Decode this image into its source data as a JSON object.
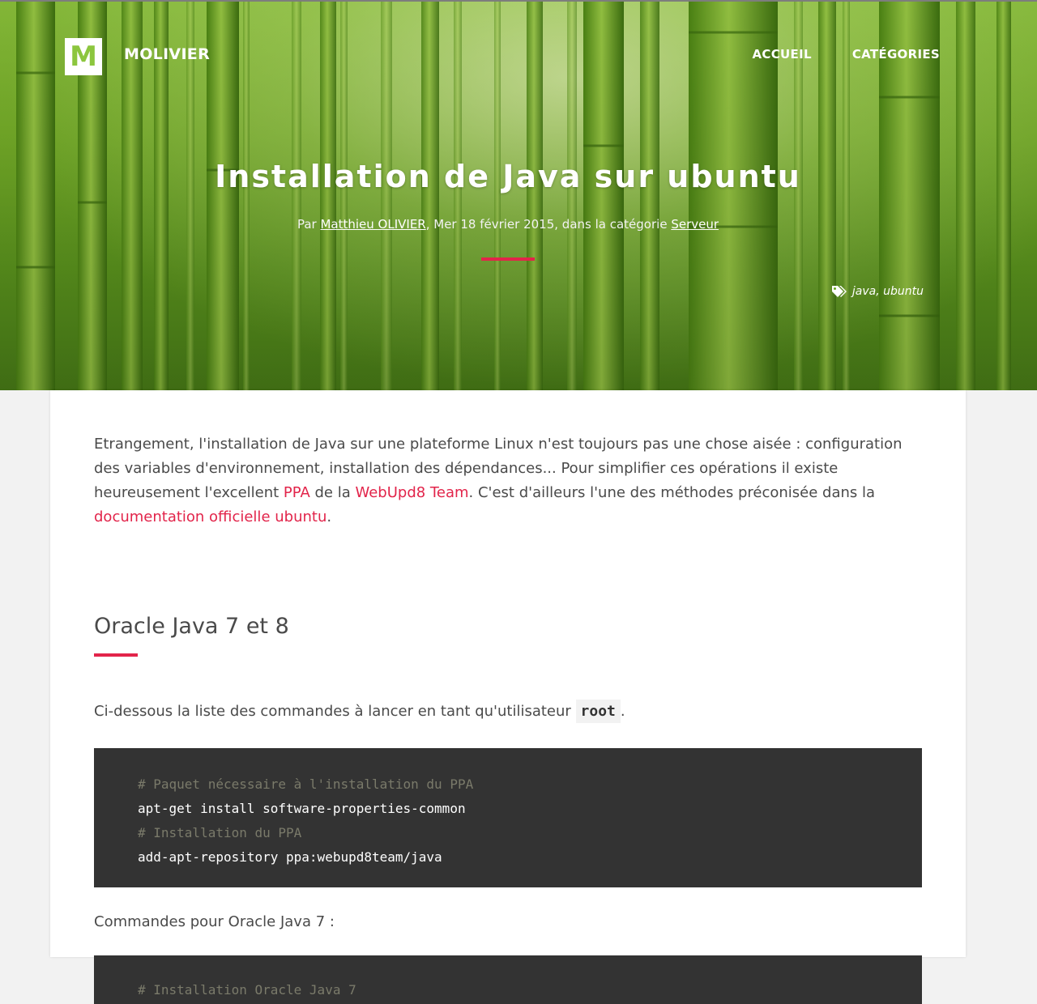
{
  "header": {
    "logo_letter": "M",
    "brand": "MOLIVIER",
    "nav": [
      "ACCUEIL",
      "CATÉGORIES"
    ]
  },
  "article": {
    "title": "Installation de Java sur ubuntu",
    "meta": {
      "prefix": "Par ",
      "author": "Matthieu OLIVIER",
      "middle": ", Mer 18 février 2015, dans la catégorie ",
      "category": "Serveur"
    },
    "tags": [
      "java",
      "ubuntu"
    ],
    "tags_separator": ", ",
    "intro": {
      "t1": "Etrangement, l'installation de Java sur une plateforme Linux n'est toujours pas une chose aisée : configuration des variables d'environnement, installation des dépendances... Pour simplifier ces opérations il existe heureusement l'excellent ",
      "link1": "PPA",
      "t2": " de la ",
      "link2": "WebUpd8 Team",
      "t3": ". C'est d'ailleurs l'une des méthodes préconisée dans la ",
      "link3": "documentation officielle ubuntu",
      "t4": "."
    },
    "section_heading": "Oracle Java 7 et 8",
    "root_para": {
      "before": "Ci-dessous la liste des commandes à lancer en tant qu'utilisateur ",
      "code": "root",
      "after": "."
    },
    "code_block_1": [
      "# Paquet nécessaire à l'installation du PPA",
      "apt-get install software-properties-common",
      "# Installation du PPA",
      "add-apt-repository ppa:webupd8team/java"
    ],
    "java7_para": "Commandes pour Oracle Java 7 :",
    "code_block_2_first_line": "# Installation Oracle Java 7"
  },
  "colors": {
    "accent": "#e2244a",
    "logo_green": "#8cc63e",
    "code_bg": "#333333"
  },
  "icons": {
    "tags": "tags-icon"
  }
}
